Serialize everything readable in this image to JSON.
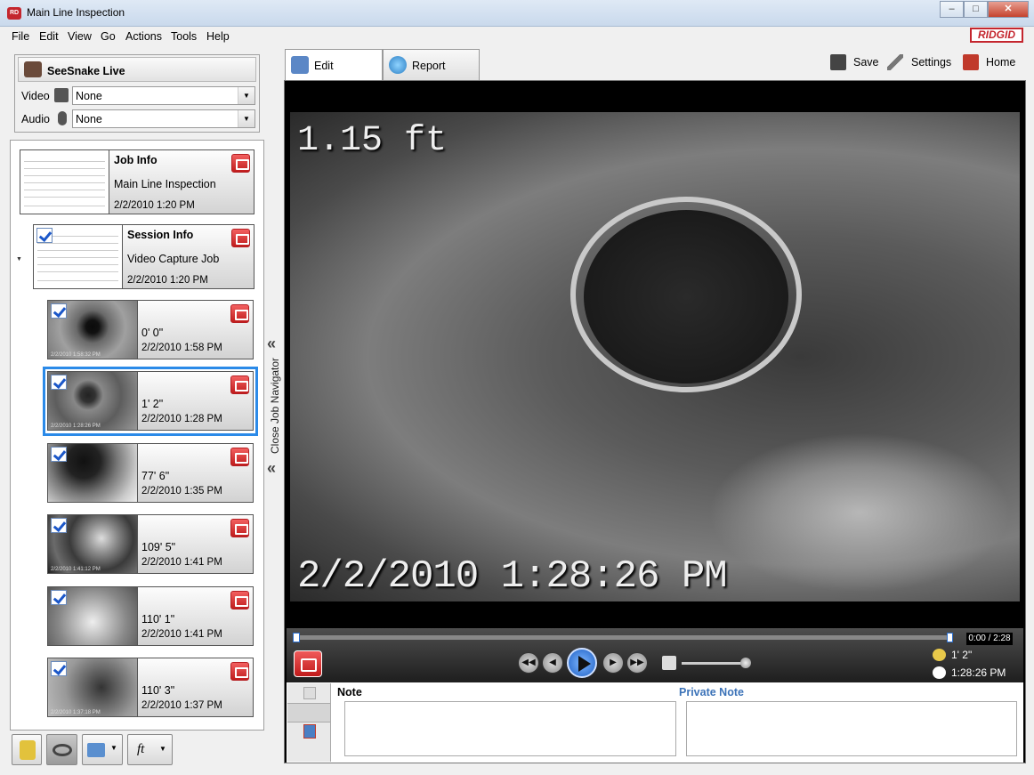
{
  "window": {
    "title": "Main Line Inspection",
    "minimize": "–",
    "maximize": "□",
    "close": "✕"
  },
  "menu": [
    "File",
    "Edit",
    "View",
    "Go",
    "Actions",
    "Tools",
    "Help"
  ],
  "brand": "RIDGID",
  "live": {
    "title": "SeeSnake Live",
    "video_label": "Video",
    "video_value": "None",
    "audio_label": "Audio",
    "audio_value": "None"
  },
  "job": {
    "title": "Job Info",
    "name": "Main Line Inspection",
    "date": "2/2/2010 1:20 PM"
  },
  "session": {
    "title": "Session Info",
    "name": "Video Capture Job",
    "date": "2/2/2010 1:20 PM"
  },
  "media": [
    {
      "distance": "0' 0\"",
      "date": "2/2/2010 1:58 PM",
      "type": "video",
      "stamp": "2/2/2010 1:58:32 PM"
    },
    {
      "distance": "1' 2\"",
      "date": "2/2/2010 1:28 PM",
      "type": "video",
      "stamp": "2/2/2010 1:28:26 PM"
    },
    {
      "distance": "77' 6\"",
      "date": "2/2/2010 1:35 PM",
      "type": "video",
      "stamp": ""
    },
    {
      "distance": "109' 5\"",
      "date": "2/2/2010 1:41 PM",
      "type": "photo",
      "stamp": "2/2/2010 1:41:12 PM"
    },
    {
      "distance": "110' 1\"",
      "date": "2/2/2010 1:41 PM",
      "type": "video",
      "stamp": ""
    },
    {
      "distance": "110' 3\"",
      "date": "2/2/2010 1:37 PM",
      "type": "photo",
      "stamp": "2/2/2010 1:37:18 PM"
    }
  ],
  "navigator": {
    "close_label": "Close Job Navigator"
  },
  "bottom_tools": {
    "unit": "ft"
  },
  "tabs": {
    "edit": "Edit",
    "report": "Report"
  },
  "actions": {
    "save": "Save",
    "settings": "Settings",
    "home": "Home"
  },
  "video": {
    "distance_overlay": "1.15 ft",
    "time_overlay": "2/2/2010 1:28:26 PM"
  },
  "player": {
    "time_total": "0:00 / 2:28",
    "distance": "1' 2\"",
    "time": "1:28:26 PM",
    "progress": 0.0,
    "volume": 0.9
  },
  "notes": {
    "note_label": "Note",
    "private_label": "Private Note"
  },
  "colors": {
    "accent": "#2b8ae8",
    "brand": "#c4262e",
    "private_note": "#3c73b8"
  }
}
